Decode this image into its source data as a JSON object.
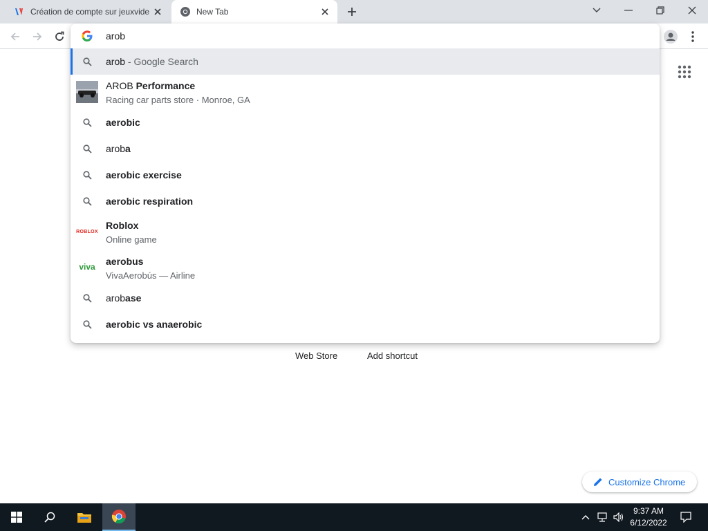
{
  "tabs": [
    {
      "title": "Création de compte sur jeuxvideo.com",
      "favicon": "jv-icon",
      "active": false
    },
    {
      "title": "New Tab",
      "favicon": "chrome-icon",
      "active": true
    }
  ],
  "omnibox": {
    "input_value": "arob",
    "suggestions": [
      {
        "type": "search",
        "query": "arob",
        "query_bold": "",
        "suffix": " - Google Search",
        "selected": true
      },
      {
        "type": "entity",
        "title_plain": "AROB ",
        "title_bold": "Performance",
        "subtitle": "Racing car parts store · Monroe, GA"
      },
      {
        "type": "search",
        "query": "",
        "query_bold": "aerobic"
      },
      {
        "type": "search",
        "query": "arob",
        "query_bold": "a"
      },
      {
        "type": "search",
        "query": "",
        "query_bold": "aerobic exercise"
      },
      {
        "type": "search",
        "query": "",
        "query_bold": "aerobic respiration"
      },
      {
        "type": "entity",
        "title_plain": "",
        "title_bold": "Roblox",
        "subtitle": "Online game",
        "logo_text": "ROBLOX"
      },
      {
        "type": "entity",
        "title_plain": "",
        "title_bold": "aerobus",
        "subtitle": "VivaAerobús — Airline",
        "logo_text": "viva"
      },
      {
        "type": "search",
        "query": "arob",
        "query_bold": "ase"
      },
      {
        "type": "search",
        "query": "",
        "query_bold": "aerobic vs anaerobic"
      }
    ]
  },
  "page": {
    "shortcuts": [
      "Web Store",
      "Add shortcut"
    ],
    "customize_label": "Customize Chrome"
  },
  "taskbar": {
    "time": "9:37 AM",
    "date": "6/12/2022"
  },
  "colors": {
    "tabstrip_bg": "#dee1e6",
    "accent_blue": "#1a73e8",
    "taskbar_bg": "#101820",
    "selected_row": "#e8eaed"
  }
}
